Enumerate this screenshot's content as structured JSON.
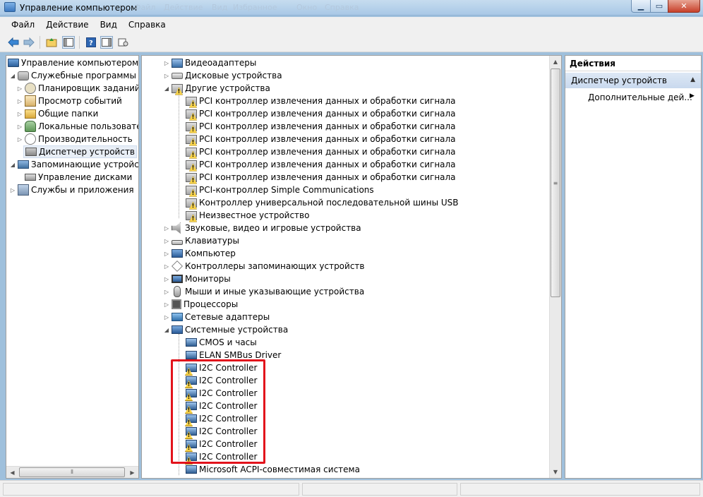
{
  "window": {
    "title": "Управление компьютером",
    "ghost_menu": [
      "Файл",
      "Действие",
      "Вид",
      "Избранное",
      "Окно",
      "Справка"
    ]
  },
  "menubar": [
    "Файл",
    "Действие",
    "Вид",
    "Справка"
  ],
  "toolbar": [
    "back-icon",
    "forward-icon",
    "up-folder-icon",
    "show-hide-tree-icon",
    "help-icon",
    "show-hide-action-pane-icon",
    "properties-icon"
  ],
  "left_tree": {
    "root": "Управление компьютером (лока",
    "utilities": "Служебные программы",
    "utilities_children": [
      "Планировщик заданий",
      "Просмотр событий",
      "Общие папки",
      "Локальные пользователи",
      "Производительность",
      "Диспетчер устройств"
    ],
    "storage": "Запоминающие устройства",
    "storage_children": [
      "Управление дисками"
    ],
    "services": "Службы и приложения"
  },
  "device_tree": {
    "top_categories": [
      "Видеоадаптеры",
      "Дисковые устройства"
    ],
    "other_devices": "Другие устройства",
    "other_children": [
      "PCI контроллер извлечения данных и обработки сигнала",
      "PCI контроллер извлечения данных и обработки сигнала",
      "PCI контроллер извлечения данных и обработки сигнала",
      "PCI контроллер извлечения данных и обработки сигнала",
      "PCI контроллер извлечения данных и обработки сигнала",
      "PCI контроллер извлечения данных и обработки сигнала",
      "PCI контроллер извлечения данных и обработки сигнала",
      "PCI-контроллер Simple Communications",
      "Контроллер универсальной последовательной шины USB",
      "Неизвестное устройство"
    ],
    "mid_categories": [
      "Звуковые, видео и игровые устройства",
      "Клавиатуры",
      "Компьютер",
      "Контроллеры запоминающих устройств",
      "Мониторы",
      "Мыши и иные указывающие устройства",
      "Процессоры",
      "Сетевые адаптеры"
    ],
    "system_devices": "Системные устройства",
    "system_children": [
      "CMOS и часы",
      "ELAN SMBus Driver",
      "I2C Controller",
      "I2C Controller",
      "I2C Controller",
      "I2C Controller",
      "I2C Controller",
      "I2C Controller",
      "I2C Controller",
      "I2C Controller",
      "Microsoft ACPI-совместимая система"
    ]
  },
  "actions": {
    "header": "Действия",
    "section": "Диспетчер устройств",
    "more": "Дополнительные дей..."
  },
  "colors": {
    "highlight": "#e2131c",
    "selection": "#e8eef6"
  }
}
